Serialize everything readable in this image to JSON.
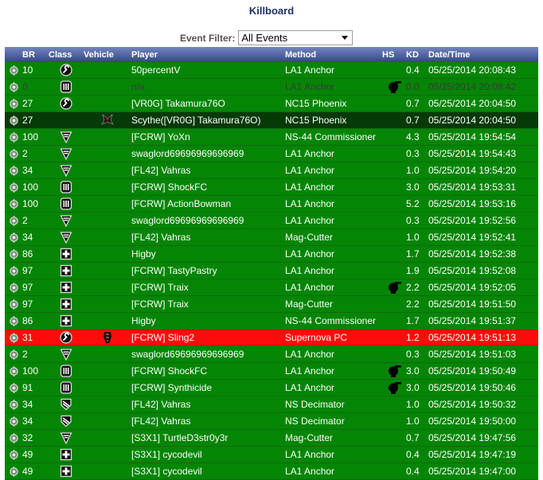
{
  "page": {
    "title": "Killboard",
    "filter_label": "Event Filter:",
    "filter_value": "All Events"
  },
  "colors": {
    "row_green": "#058505",
    "row_dark": "#063a06",
    "row_red": "#ff0b0b",
    "header_top": "#7486bf",
    "header_bottom": "#32468a",
    "title": "#1c2f6e"
  },
  "columns": {
    "br": "BR",
    "class": "Class",
    "vehicle": "Vehicle",
    "player": "Player",
    "method": "Method",
    "hs": "HS",
    "kd": "KD",
    "datetime": "Date/Time"
  },
  "rows": [
    {
      "br": "10",
      "class_icon": "engineer-icon",
      "vehicle_icon": "",
      "player": "50percentV",
      "method": "LA1 Anchor",
      "hs": false,
      "kd": "0.4",
      "datetime": "05/25/2014 20:08:43",
      "style": "normal"
    },
    {
      "br": "0",
      "class_icon": "max-icon",
      "vehicle_icon": "",
      "player": "n/a",
      "method": "LA1 Anchor",
      "hs": true,
      "kd": "0.0",
      "datetime": "05/25/2014 20:08:42",
      "style": "dim"
    },
    {
      "br": "27",
      "class_icon": "engineer-icon",
      "vehicle_icon": "",
      "player": "[VR0G] Takamura76O",
      "method": "NC15 Phoenix",
      "hs": false,
      "kd": "0.7",
      "datetime": "05/25/2014 20:04:50",
      "style": "normal"
    },
    {
      "br": "27",
      "class_icon": "",
      "vehicle_icon": "sunderer-icon",
      "player": "Scythe([VR0G] Takamura76O)",
      "method": "NC15 Phoenix",
      "hs": false,
      "kd": "0.7",
      "datetime": "05/25/2014 20:04:50",
      "style": "self"
    },
    {
      "br": "100",
      "class_icon": "infiltrator-icon",
      "vehicle_icon": "",
      "player": "[FCRW] YoXn",
      "method": "NS-44 Commissioner",
      "hs": false,
      "kd": "4.3",
      "datetime": "05/25/2014 19:54:54",
      "style": "normal"
    },
    {
      "br": "2",
      "class_icon": "infiltrator-icon",
      "vehicle_icon": "",
      "player": "swaglord69696969696969",
      "method": "LA1 Anchor",
      "hs": false,
      "kd": "0.3",
      "datetime": "05/25/2014 19:54:43",
      "style": "normal"
    },
    {
      "br": "34",
      "class_icon": "infiltrator-icon",
      "vehicle_icon": "",
      "player": "[FL42] Vahras",
      "method": "LA1 Anchor",
      "hs": false,
      "kd": "1.0",
      "datetime": "05/25/2014 19:54:20",
      "style": "normal"
    },
    {
      "br": "100",
      "class_icon": "max-icon",
      "vehicle_icon": "",
      "player": "[FCRW] ShockFC",
      "method": "LA1 Anchor",
      "hs": false,
      "kd": "3.0",
      "datetime": "05/25/2014 19:53:31",
      "style": "normal"
    },
    {
      "br": "100",
      "class_icon": "max-icon",
      "vehicle_icon": "",
      "player": "[FCRW] ActionBowman",
      "method": "LA1 Anchor",
      "hs": false,
      "kd": "5.2",
      "datetime": "05/25/2014 19:53:16",
      "style": "normal"
    },
    {
      "br": "2",
      "class_icon": "infiltrator-icon",
      "vehicle_icon": "",
      "player": "swaglord69696969696969",
      "method": "LA1 Anchor",
      "hs": false,
      "kd": "0.3",
      "datetime": "05/25/2014 19:52:56",
      "style": "normal"
    },
    {
      "br": "34",
      "class_icon": "infiltrator-icon",
      "vehicle_icon": "",
      "player": "[FL42] Vahras",
      "method": "Mag-Cutter",
      "hs": false,
      "kd": "1.0",
      "datetime": "05/25/2014 19:52:41",
      "style": "normal"
    },
    {
      "br": "86",
      "class_icon": "medic-icon",
      "vehicle_icon": "",
      "player": "Higby",
      "method": "LA1 Anchor",
      "hs": false,
      "kd": "1.7",
      "datetime": "05/25/2014 19:52:38",
      "style": "normal"
    },
    {
      "br": "97",
      "class_icon": "medic-icon",
      "vehicle_icon": "",
      "player": "[FCRW] TastyPastry",
      "method": "LA1 Anchor",
      "hs": false,
      "kd": "1.9",
      "datetime": "05/25/2014 19:52:08",
      "style": "normal"
    },
    {
      "br": "97",
      "class_icon": "medic-icon",
      "vehicle_icon": "",
      "player": "[FCRW] Traix",
      "method": "LA1 Anchor",
      "hs": true,
      "kd": "2.2",
      "datetime": "05/25/2014 19:52:05",
      "style": "normal"
    },
    {
      "br": "97",
      "class_icon": "medic-icon",
      "vehicle_icon": "",
      "player": "[FCRW] Traix",
      "method": "Mag-Cutter",
      "hs": false,
      "kd": "2.2",
      "datetime": "05/25/2014 19:51:50",
      "style": "normal"
    },
    {
      "br": "86",
      "class_icon": "medic-icon",
      "vehicle_icon": "",
      "player": "Higby",
      "method": "NS-44 Commissioner",
      "hs": false,
      "kd": "1.7",
      "datetime": "05/25/2014 19:51:37",
      "style": "normal"
    },
    {
      "br": "31",
      "class_icon": "engineer-icon",
      "vehicle_icon": "flash-icon",
      "player": "[FCRW] Sling2",
      "method": "Supernova PC",
      "hs": false,
      "kd": "1.2",
      "datetime": "05/25/2014 19:51:13",
      "style": "red"
    },
    {
      "br": "2",
      "class_icon": "infiltrator-icon",
      "vehicle_icon": "",
      "player": "swaglord69696969696969",
      "method": "LA1 Anchor",
      "hs": false,
      "kd": "0.3",
      "datetime": "05/25/2014 19:51:03",
      "style": "normal"
    },
    {
      "br": "100",
      "class_icon": "max-icon",
      "vehicle_icon": "",
      "player": "[FCRW] ShockFC",
      "method": "LA1 Anchor",
      "hs": true,
      "kd": "3.0",
      "datetime": "05/25/2014 19:50:49",
      "style": "normal"
    },
    {
      "br": "91",
      "class_icon": "max-icon",
      "vehicle_icon": "",
      "player": "[FCRW] Synthicide",
      "method": "LA1 Anchor",
      "hs": true,
      "kd": "3.0",
      "datetime": "05/25/2014 19:50:46",
      "style": "normal"
    },
    {
      "br": "34",
      "class_icon": "heavy-assault-icon",
      "vehicle_icon": "",
      "player": "[FL42] Vahras",
      "method": "NS Decimator",
      "hs": false,
      "kd": "1.0",
      "datetime": "05/25/2014 19:50:32",
      "style": "normal"
    },
    {
      "br": "34",
      "class_icon": "heavy-assault-icon",
      "vehicle_icon": "",
      "player": "[FL42] Vahras",
      "method": "NS Decimator",
      "hs": false,
      "kd": "1.0",
      "datetime": "05/25/2014 19:50:00",
      "style": "normal"
    },
    {
      "br": "32",
      "class_icon": "infiltrator-icon",
      "vehicle_icon": "",
      "player": "[S3X1] TurtleD3str0y3r",
      "method": "Mag-Cutter",
      "hs": false,
      "kd": "0.7",
      "datetime": "05/25/2014 19:47:56",
      "style": "normal"
    },
    {
      "br": "49",
      "class_icon": "medic-icon",
      "vehicle_icon": "",
      "player": "[S3X1] cycodevil",
      "method": "LA1 Anchor",
      "hs": false,
      "kd": "0.4",
      "datetime": "05/25/2014 19:47:19",
      "style": "normal"
    },
    {
      "br": "49",
      "class_icon": "medic-icon",
      "vehicle_icon": "",
      "player": "[S3X1] cycodevil",
      "method": "LA1 Anchor",
      "hs": false,
      "kd": "0.4",
      "datetime": "05/25/2014 19:47:00",
      "style": "normal"
    }
  ]
}
